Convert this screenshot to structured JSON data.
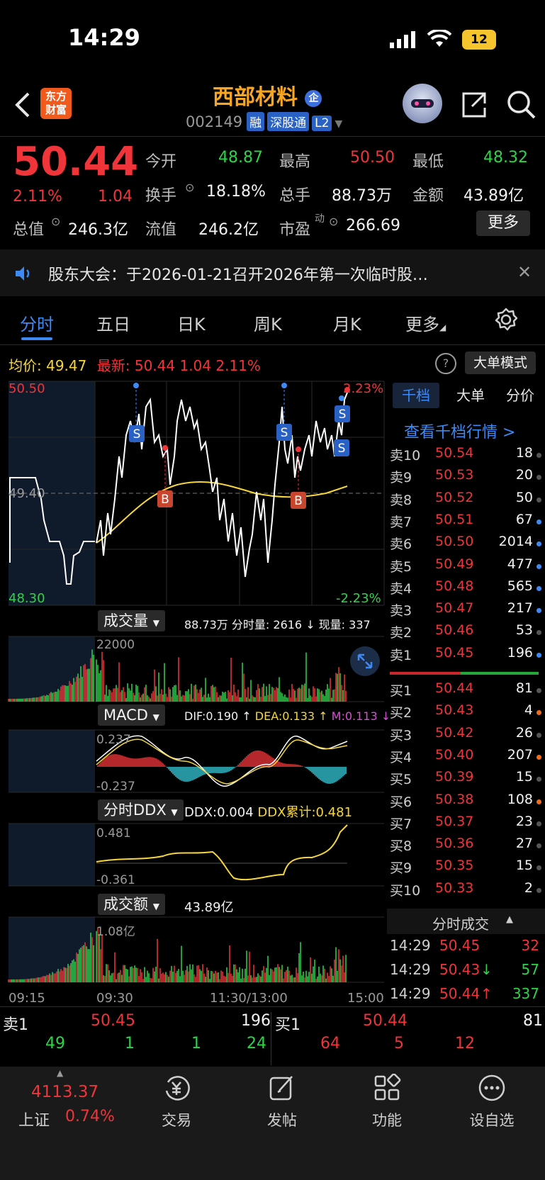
{
  "status_bar": {
    "time": "14:29",
    "battery": "12"
  },
  "header": {
    "logo_text_1": "东方",
    "logo_text_2": "财富",
    "stock_name": "西部材料",
    "stock_badge": "企",
    "stock_code": "002149",
    "tags": [
      "融",
      "深股通",
      "L2"
    ]
  },
  "quote": {
    "price": "50.44",
    "change_pct": "2.11%",
    "change": "1.04",
    "open_label": "今开",
    "open": "48.87",
    "high_label": "最高",
    "high": "50.50",
    "low_label": "最低",
    "low": "48.32",
    "turnover_label": "换手",
    "turnover": "18.18%",
    "volume_label": "总手",
    "volume": "88.73万",
    "amount_label": "金额",
    "amount": "43.89亿",
    "mktcap_label": "总值",
    "mktcap": "246.3亿",
    "float_label": "流值",
    "float_cap": "246.2亿",
    "pe_label": "市盈",
    "pe_sup": "动",
    "pe": "266.69",
    "more_button": "更多"
  },
  "notice": {
    "text": "股东大会：于2026-01-21召开2026年第一次临时股…"
  },
  "tabs": [
    "分时",
    "五日",
    "日K",
    "周K",
    "月K",
    "更多"
  ],
  "chart_header": {
    "avg_label": "均价:",
    "avg": "49.47",
    "latest_label": "最新:",
    "latest": "50.44",
    "latest_change": "1.04",
    "latest_pct": "2.11%",
    "mode_button": "大单模式"
  },
  "price_axis": {
    "top": "50.50",
    "mid": "49.40",
    "bottom": "48.30",
    "top_pct": "2.23%",
    "bottom_pct": "-2.23%"
  },
  "volume_panel": {
    "label": "成交量",
    "total": "88.73万",
    "detail": "分时量: 2616 ↓ 现量: 337",
    "axis": "22000"
  },
  "macd_panel": {
    "label": "MACD",
    "dif": "DIF:0.190 ↑",
    "dea": "DEA:0.133 ↑",
    "m": "M:0.113 ↓",
    "axis_top": "0.237",
    "axis_bottom": "-0.237"
  },
  "ddx_panel": {
    "label": "分时DDX",
    "ddx": "DDX:0.004",
    "ddx_sum": "DDX累计:0.481",
    "axis_top": "0.481",
    "axis_bottom": "-0.361"
  },
  "amount_panel": {
    "label": "成交额",
    "total": "43.89亿",
    "axis": "1.08亿"
  },
  "time_axis": [
    "09:15",
    "09:30",
    "11:30/13:00",
    "15:00"
  ],
  "order_tabs": [
    "千档",
    "大单",
    "分价"
  ],
  "order_link": "查看千档行情 >",
  "asks": [
    {
      "label": "卖10",
      "price": "50.54",
      "vol": "18",
      "dot": "#555555"
    },
    {
      "label": "卖9",
      "price": "50.53",
      "vol": "20",
      "dot": "#555555"
    },
    {
      "label": "卖8",
      "price": "50.52",
      "vol": "50",
      "dot": "#555555"
    },
    {
      "label": "卖7",
      "price": "50.51",
      "vol": "67",
      "dot": "#3d8af7"
    },
    {
      "label": "卖6",
      "price": "50.50",
      "vol": "2014",
      "dot": "#3d8af7"
    },
    {
      "label": "卖5",
      "price": "50.49",
      "vol": "477",
      "dot": "#3d8af7"
    },
    {
      "label": "卖4",
      "price": "50.48",
      "vol": "565",
      "dot": "#3d8af7"
    },
    {
      "label": "卖3",
      "price": "50.47",
      "vol": "217",
      "dot": "#3d8af7"
    },
    {
      "label": "卖2",
      "price": "50.46",
      "vol": "53",
      "dot": "#555555"
    },
    {
      "label": "卖1",
      "price": "50.45",
      "vol": "196",
      "dot": "#3d8af7"
    }
  ],
  "bids": [
    {
      "label": "买1",
      "price": "50.44",
      "vol": "81",
      "dot": "#555555"
    },
    {
      "label": "买2",
      "price": "50.43",
      "vol": "4",
      "dot": "#f26b1d"
    },
    {
      "label": "买3",
      "price": "50.42",
      "vol": "26",
      "dot": "#555555"
    },
    {
      "label": "买4",
      "price": "50.40",
      "vol": "207",
      "dot": "#f26b1d"
    },
    {
      "label": "买5",
      "price": "50.39",
      "vol": "15",
      "dot": "#555555"
    },
    {
      "label": "买6",
      "price": "50.38",
      "vol": "108",
      "dot": "#f26b1d"
    },
    {
      "label": "买7",
      "price": "50.37",
      "vol": "23",
      "dot": "#555555"
    },
    {
      "label": "买8",
      "price": "50.36",
      "vol": "27",
      "dot": "#555555"
    },
    {
      "label": "买9",
      "price": "50.35",
      "vol": "15",
      "dot": "#555555"
    },
    {
      "label": "买10",
      "price": "50.33",
      "vol": "2",
      "dot": "#555555"
    }
  ],
  "trades_header": "分时成交",
  "trades": [
    {
      "time": "14:29",
      "price": "50.45",
      "vol": "32",
      "arrow": ""
    },
    {
      "time": "14:29",
      "price": "50.43",
      "vol": "57",
      "arrow": "↓"
    },
    {
      "time": "14:29",
      "price": "50.44",
      "vol": "337",
      "arrow": "↑"
    }
  ],
  "bottom_quote": {
    "sell_label": "卖1",
    "sell_price": "50.45",
    "sell_vol": "196",
    "buy_label": "买1",
    "buy_price": "50.44",
    "buy_vol": "81",
    "sell_queue": [
      "49",
      "1",
      "1",
      "24"
    ],
    "buy_queue": [
      "64",
      "5",
      "12"
    ]
  },
  "nav": {
    "index_value": "4113.37",
    "index_name": "上证",
    "index_pct": "0.74%",
    "items": [
      "交易",
      "发帖",
      "功能",
      "设自选"
    ]
  },
  "colors": {
    "up": "#f0353a",
    "down": "#2fd34a",
    "accent": "#3d8af7",
    "avg_line": "#f6d63d"
  }
}
